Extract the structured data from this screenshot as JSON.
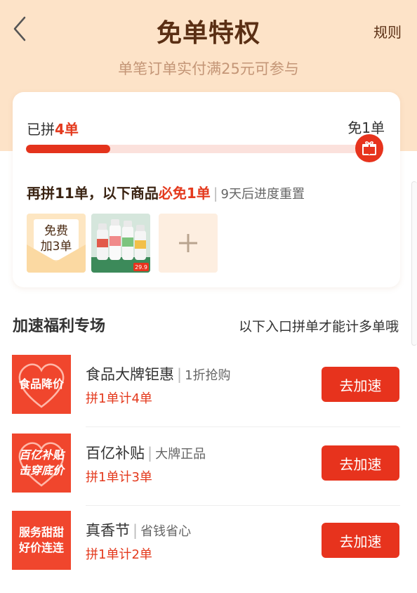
{
  "header": {
    "title": "免单特权",
    "rules_label": "规则",
    "subtitle": "单笔订单实付满25元可参与"
  },
  "progress_card": {
    "joined_prefix": "已拼",
    "joined_count": "4单",
    "goal_label": "免1单",
    "progress_fraction": 0.25,
    "promo_part1": "再拼11单，以下商品",
    "promo_highlight": "必免1单",
    "promo_sep": "|",
    "promo_reset": "9天后进度重置",
    "free_thumb_line1": "免费",
    "free_thumb_line2": "加3单",
    "product_price": "29.9",
    "add_icon": "plus-icon"
  },
  "boost": {
    "title": "加速福利专场",
    "hint": "以下入口拼单才能计多单哦",
    "items": [
      {
        "logo_line1": "食品降价",
        "logo_line2": "",
        "name": "食品大牌钜惠",
        "sep": "|",
        "tag": "1折抢购",
        "count_label": "拼1单计4单",
        "button_label": "去加速"
      },
      {
        "logo_line1": "百亿补贴",
        "logo_line2": "击穿底价",
        "name": "百亿补贴",
        "sep": "|",
        "tag": "大牌正品",
        "count_label": "拼1单计3单",
        "button_label": "去加速"
      },
      {
        "logo_line1": "服务甜甜",
        "logo_line2": "好价连连",
        "name": "真香节",
        "sep": "|",
        "tag": "省钱省心",
        "count_label": "拼1单计2单",
        "button_label": "去加速"
      }
    ]
  },
  "colors": {
    "accent": "#e7331d",
    "header_bg": "#fde3c8",
    "title_brown": "#5a2f14"
  }
}
